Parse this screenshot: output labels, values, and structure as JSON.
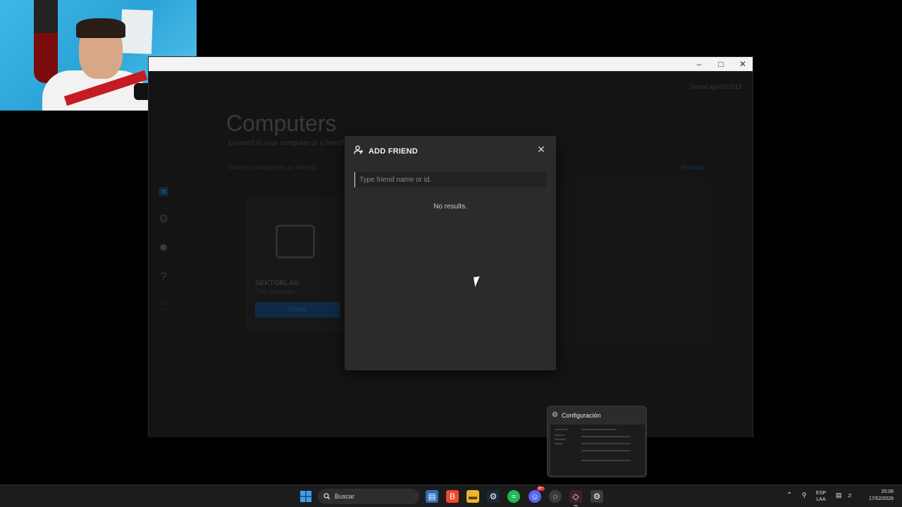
{
  "app": {
    "bg_title": "Computers",
    "bg_subtitle": "Connect to your computer or a friend's",
    "account_label": "SektorLag#1527213",
    "reload_label": "Reload",
    "search_placeholder": "Search computers or friends",
    "computer": {
      "name": "SEKTORLAG",
      "sub": "This computer",
      "button": "Share"
    }
  },
  "modal": {
    "title": "ADD FRIEND",
    "input_placeholder": "Type friend name or id.",
    "input_value": "",
    "empty_text": "No results."
  },
  "preview": {
    "title": "Configuración"
  },
  "taskbar": {
    "search_label": "Buscar",
    "lang_1": "ESP",
    "lang_2": "LAA",
    "time": "20:06",
    "date": "17/02/2026",
    "discord_badge": "9+"
  },
  "colors": {
    "accent": "#1e6fd9",
    "modal_bg": "#2b2b2b"
  }
}
